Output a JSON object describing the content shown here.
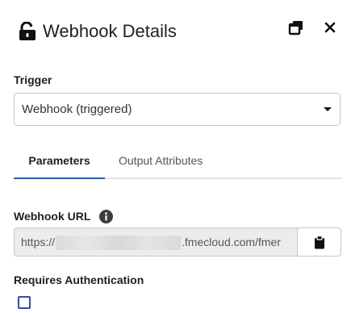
{
  "header": {
    "title": "Webhook Details",
    "lock_icon": "unlocked-padlock-icon",
    "popout_icon": "popout-window-icon",
    "close_icon": "close-icon"
  },
  "trigger": {
    "label": "Trigger",
    "selected": "Webhook (triggered)"
  },
  "tabs": [
    {
      "label": "Parameters",
      "active": true
    },
    {
      "label": "Output Attributes",
      "active": false
    }
  ],
  "webhook_url": {
    "label": "Webhook URL",
    "value_prefix": "https://",
    "value_suffix": ".fmecloud.com/fmer",
    "info_icon": "info-icon",
    "copy_icon": "clipboard-icon"
  },
  "auth": {
    "label": "Requires Authentication",
    "checked": false
  },
  "colors": {
    "accent": "#2e5fa8",
    "checkbox_border": "#3a4fa0",
    "field_disabled_bg": "#ececec"
  }
}
